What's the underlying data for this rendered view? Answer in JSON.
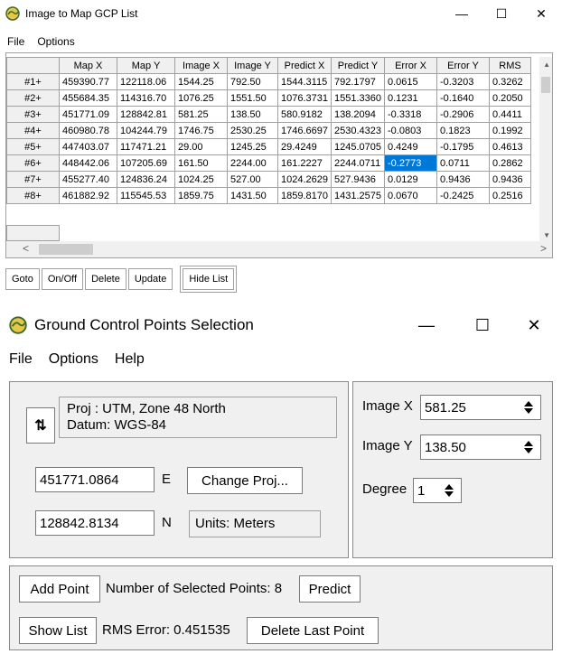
{
  "win1": {
    "title": "Image to Map GCP List",
    "menu": [
      "File",
      "Options"
    ],
    "columns": [
      "Map X",
      "Map Y",
      "Image X",
      "Image Y",
      "Predict X",
      "Predict Y",
      "Error X",
      "Error Y",
      "RMS"
    ],
    "rows": [
      {
        "id": "#1+",
        "cells": [
          "459390.77",
          "122118.06",
          "1544.25",
          "792.50",
          "1544.3115",
          "792.1797",
          "0.0615",
          "-0.3203",
          "0.3262"
        ]
      },
      {
        "id": "#2+",
        "cells": [
          "455684.35",
          "114316.70",
          "1076.25",
          "1551.50",
          "1076.3731",
          "1551.3360",
          "0.1231",
          "-0.1640",
          "0.2050"
        ]
      },
      {
        "id": "#3+",
        "cells": [
          "451771.09",
          "128842.81",
          "581.25",
          "138.50",
          "580.9182",
          "138.2094",
          "-0.3318",
          "-0.2906",
          "0.4411"
        ]
      },
      {
        "id": "#4+",
        "cells": [
          "460980.78",
          "104244.79",
          "1746.75",
          "2530.25",
          "1746.6697",
          "2530.4323",
          "-0.0803",
          "0.1823",
          "0.1992"
        ]
      },
      {
        "id": "#5+",
        "cells": [
          "447403.07",
          "117471.21",
          "29.00",
          "1245.25",
          "29.4249",
          "1245.0705",
          "0.4249",
          "-0.1795",
          "0.4613"
        ]
      },
      {
        "id": "#6+",
        "cells": [
          "448442.06",
          "107205.69",
          "161.50",
          "2244.00",
          "161.2227",
          "2244.0711",
          "-0.2773",
          "0.0711",
          "0.2862"
        ]
      },
      {
        "id": "#7+",
        "cells": [
          "455277.40",
          "124836.24",
          "1024.25",
          "527.00",
          "1024.2629",
          "527.9436",
          "0.0129",
          "0.9436",
          "0.9436"
        ]
      },
      {
        "id": "#8+",
        "cells": [
          "461882.92",
          "115545.53",
          "1859.75",
          "1431.50",
          "1859.8170",
          "1431.2575",
          "0.0670",
          "-0.2425",
          "0.2516"
        ]
      }
    ],
    "buttons": {
      "goto": "Goto",
      "onoff": "On/Off",
      "delete": "Delete",
      "update": "Update",
      "hide_list": "Hide List"
    }
  },
  "win2": {
    "title": "Ground Control Points Selection",
    "menu": [
      "File",
      "Options",
      "Help"
    ],
    "proj_line1": "Proj : UTM, Zone 48 North",
    "proj_line2": "Datum: WGS-84",
    "easting_value": "451771.0864",
    "easting_unit": "E",
    "northing_value": "128842.8134",
    "northing_unit": "N",
    "change_proj": "Change Proj...",
    "units": "Units: Meters",
    "image_x_label": "Image X",
    "image_x_value": "581.25",
    "image_y_label": "Image Y",
    "image_y_value": "138.50",
    "degree_label": "Degree",
    "degree_value": "1",
    "add_point": "Add Point",
    "num_selected": "Number of Selected Points: 8",
    "predict": "Predict",
    "show_list": "Show List",
    "rms_error": "RMS Error: 0.451535",
    "delete_last": "Delete Last Point"
  },
  "icons": {
    "app": "globe-icon",
    "swap": "swap-arrows-icon",
    "spinner": "spinner-icon"
  },
  "selected_cell": {
    "row": 5,
    "col": 6,
    "color": "#0078d7"
  }
}
